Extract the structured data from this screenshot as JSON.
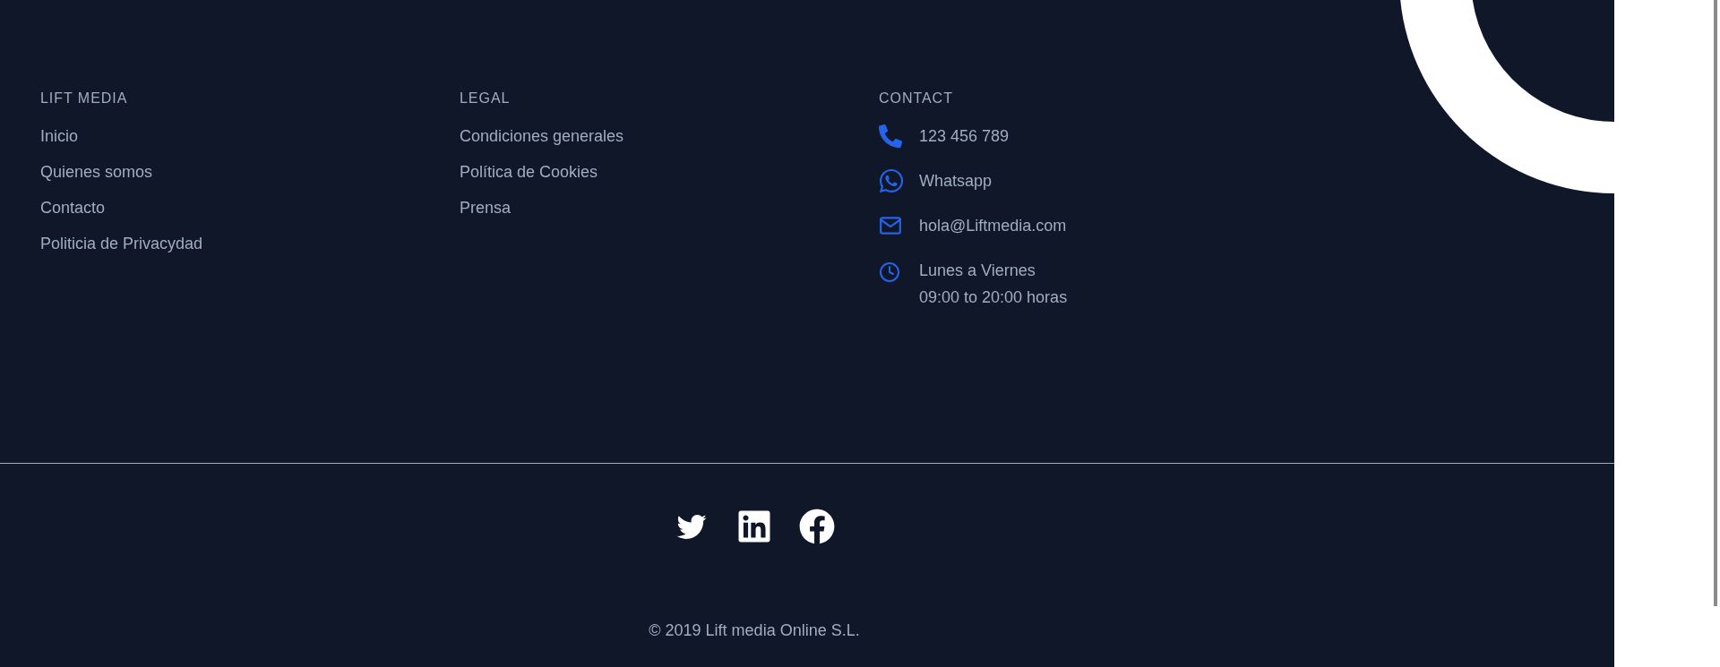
{
  "columns": [
    {
      "heading": "LIFT MEDIA",
      "links": [
        "Inicio",
        "Quienes somos",
        "Contacto",
        "Politicia de Privacydad"
      ]
    },
    {
      "heading": "LEGAL",
      "links": [
        "Condiciones generales",
        "Política de Cookies",
        "Prensa"
      ]
    }
  ],
  "contact": {
    "heading": "CONTACT",
    "items": [
      {
        "kind": "phone",
        "lines": [
          "123 456 789"
        ]
      },
      {
        "kind": "whatsapp",
        "lines": [
          "Whatsapp"
        ]
      },
      {
        "kind": "email",
        "lines": [
          "hola@Liftmedia.com"
        ]
      },
      {
        "kind": "hours",
        "lines": [
          "Lunes a Viernes",
          "09:00 to 20:00 horas"
        ]
      }
    ]
  },
  "social": [
    {
      "kind": "twitter"
    },
    {
      "kind": "linkedin"
    },
    {
      "kind": "facebook"
    }
  ],
  "copyright": "© 2019 Lift media Online S.L."
}
